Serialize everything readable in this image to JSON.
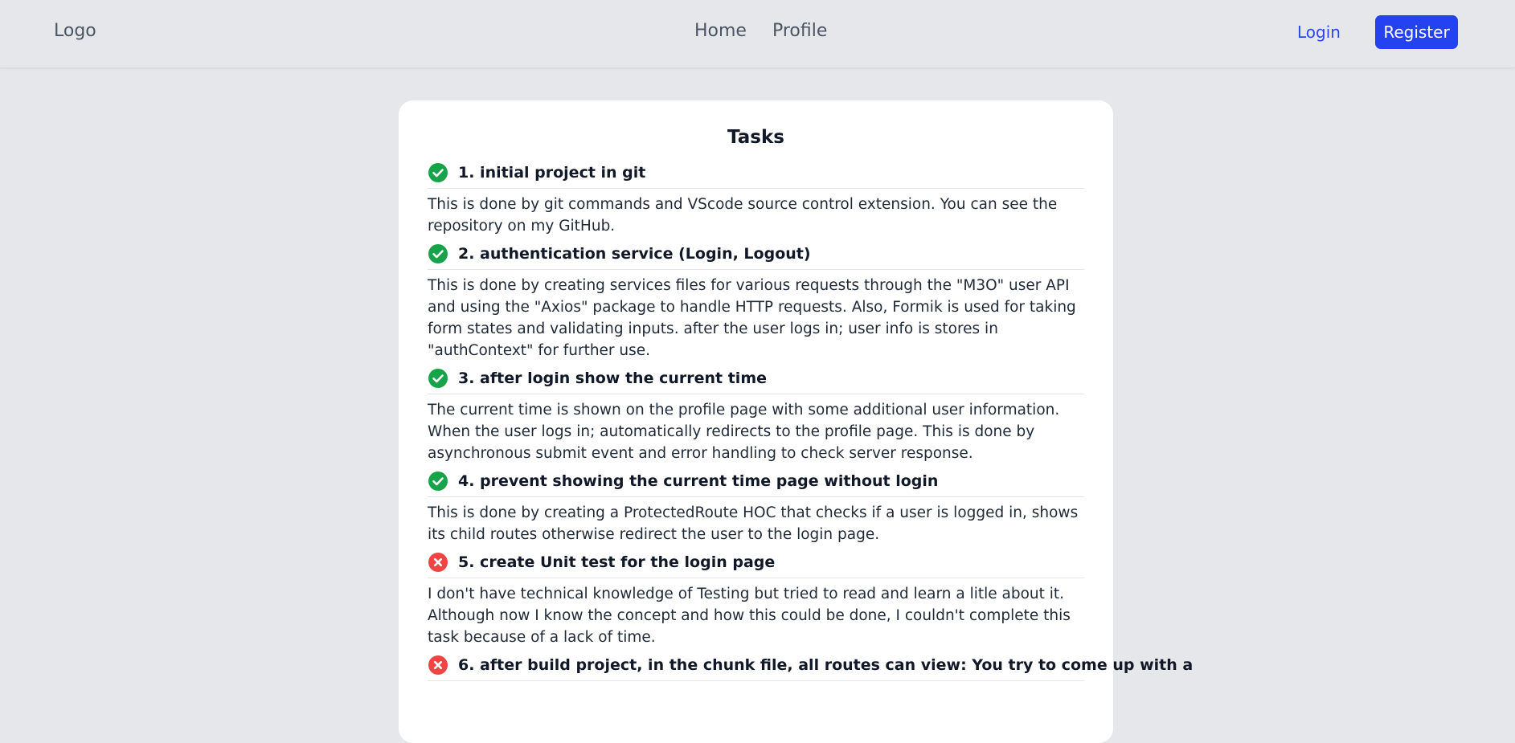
{
  "navbar": {
    "logo": "Logo",
    "links": [
      "Home",
      "Profile"
    ],
    "login_label": "Login",
    "register_label": "Register"
  },
  "colors": {
    "accent": "#2442f0",
    "done": "#16a34a",
    "failed": "#ef4444"
  },
  "tasks_card": {
    "title": "Tasks",
    "tasks": [
      {
        "status": "done",
        "status_icon": "check-circle-icon",
        "title": "1. initial project in git",
        "description": "This is done by git commands and VScode source control extension. You can see the repository on my GitHub."
      },
      {
        "status": "done",
        "status_icon": "check-circle-icon",
        "title": "2. authentication service (Login, Logout)",
        "description": "This is done by creating services files for various requests through the \"M3O\" user API and using the \"Axios\" package to handle HTTP requests. Also, Formik is used for taking form states and validating inputs. after the user logs in; user info is stores in \"authContext\" for further use."
      },
      {
        "status": "done",
        "status_icon": "check-circle-icon",
        "title": "3. after login show the current time",
        "description": "The current time is shown on the profile page with some additional user information. When the user logs in; automatically redirects to the profile page. This is done by asynchronous submit event and error handling to check server response."
      },
      {
        "status": "done",
        "status_icon": "check-circle-icon",
        "title": "4. prevent showing the current time page without login",
        "description": "This is done by creating a ProtectedRoute HOC that checks if a user is logged in, shows its child routes otherwise redirect the user to the login page."
      },
      {
        "status": "failed",
        "status_icon": "x-circle-icon",
        "title": "5. create Unit test for the login page",
        "description": "I don't have technical knowledge of Testing but tried to read and learn a litle about it. Although now I know the concept and how this could be done, I couldn't complete this task because of a lack of time."
      },
      {
        "status": "failed",
        "status_icon": "x-circle-icon",
        "title": "6. after build project, in the chunk file, all routes can view: You try to come up with a",
        "description": ""
      }
    ]
  }
}
